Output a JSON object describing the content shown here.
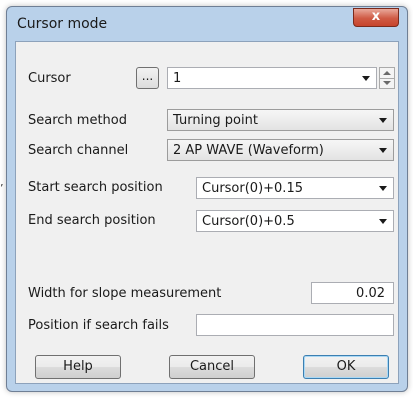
{
  "window": {
    "title": "Cursor mode",
    "close_glyph": "x"
  },
  "fields": {
    "cursor": {
      "label": "Cursor",
      "browse_label": "...",
      "value": "1"
    },
    "search_method": {
      "label": "Search method",
      "value": "Turning point"
    },
    "search_channel": {
      "label": "Search channel",
      "value": "2 AP WAVE (Waveform)"
    },
    "start_search_position": {
      "label": "Start search position",
      "value": "Cursor(0)+0.15"
    },
    "end_search_position": {
      "label": "End search position",
      "value": "Cursor(0)+0.5"
    },
    "slope_width": {
      "label": "Width for slope measurement",
      "value": "0.02"
    },
    "position_if_fails": {
      "label": "Position if search fails",
      "value": ""
    }
  },
  "buttons": {
    "help": "Help",
    "cancel": "Cancel",
    "ok": "OK"
  },
  "stray_mark": "’",
  "icons": {
    "close": "close-icon",
    "dropdown": "chevron-down-icon",
    "spin_up": "spin-up-icon",
    "spin_down": "spin-down-icon"
  }
}
